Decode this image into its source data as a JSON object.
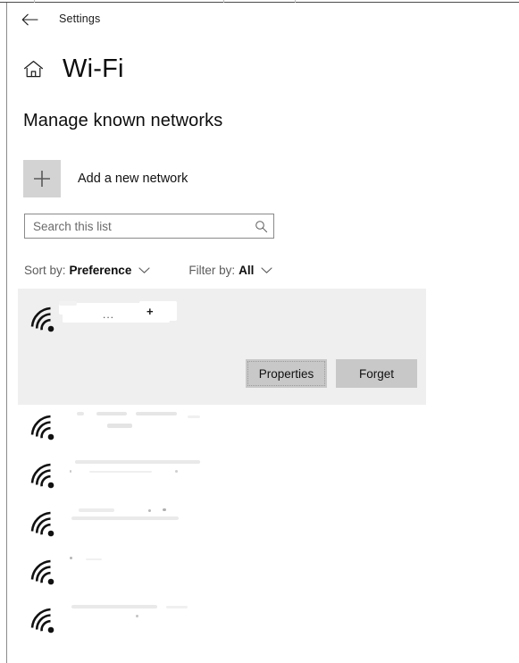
{
  "window": {
    "title_bar_label": "Settings",
    "back_icon": "back-arrow-icon"
  },
  "header": {
    "home_icon": "home-icon",
    "page_title": "Wi-Fi"
  },
  "section": {
    "heading": "Manage known networks"
  },
  "add_network": {
    "icon": "plus-icon",
    "label": "Add a new network"
  },
  "search": {
    "value": "",
    "placeholder": "Search this list",
    "icon": "search-icon"
  },
  "controls": {
    "sort": {
      "prefix": "Sort by:",
      "value": "Preference",
      "chevron": "chevron-down-icon"
    },
    "filter": {
      "prefix": "Filter by:",
      "value": "All",
      "chevron": "chevron-down-icon"
    }
  },
  "network_list": {
    "selected_index": 0,
    "items": [
      {
        "icon": "wifi-icon",
        "name": "",
        "redacted": true,
        "selected": true,
        "dots": "...",
        "plus": "+"
      },
      {
        "icon": "wifi-icon",
        "name": "",
        "redacted": true,
        "selected": false
      },
      {
        "icon": "wifi-icon",
        "name": "",
        "redacted": true,
        "selected": false
      },
      {
        "icon": "wifi-icon",
        "name": "",
        "redacted": true,
        "selected": false
      },
      {
        "icon": "wifi-icon",
        "name": "",
        "redacted": true,
        "selected": false
      },
      {
        "icon": "wifi-icon",
        "name": "",
        "redacted": true,
        "selected": false
      }
    ],
    "actions": {
      "properties_label": "Properties",
      "forget_label": "Forget"
    }
  },
  "colors": {
    "page_background": "#ffffff",
    "selected_row": "#efefef",
    "action_button": "#c8c8c8",
    "add_button": "#d3d3d3",
    "text_primary": "#0d0d0d",
    "text_secondary": "#5c5c5c",
    "border": "#8a8a8a"
  }
}
